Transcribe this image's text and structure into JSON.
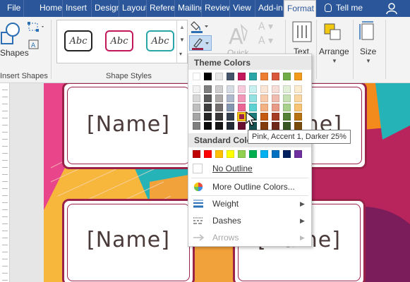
{
  "tabs": [
    {
      "label": "File"
    },
    {
      "label": "Home"
    },
    {
      "label": "Insert"
    },
    {
      "label": "Design"
    },
    {
      "label": "Layout"
    },
    {
      "label": "References"
    },
    {
      "label": "Mailings"
    },
    {
      "label": "Review"
    },
    {
      "label": "View"
    },
    {
      "label": "Add-ins"
    },
    {
      "label": "Format"
    }
  ],
  "tell_me": "Tell me",
  "ribbon": {
    "insert_shapes_group": "Insert Shapes",
    "shapes_label": "Shapes",
    "shape_styles_group": "Shape Styles",
    "style_samples": [
      "Abc",
      "Abc",
      "Abc"
    ],
    "quick_label": "Quick",
    "text_label": "Text",
    "arrange_label": "Arrange",
    "size_label": "Size"
  },
  "document": {
    "card_text": "[Name]"
  },
  "outline_menu": {
    "theme_colors_header": "Theme Colors",
    "standard_colors_header": "Standard Colors",
    "no_outline": "No Outline",
    "more_colors": "More Outline Colors...",
    "weight": "Weight",
    "dashes": "Dashes",
    "arrows": "Arrows"
  },
  "tooltip": "Pink, Accent 1, Darker 25%",
  "colors": {
    "title_bar": "#2b579a",
    "accent_pink": "#9b2349",
    "selection_highlight": "#f2c811"
  }
}
